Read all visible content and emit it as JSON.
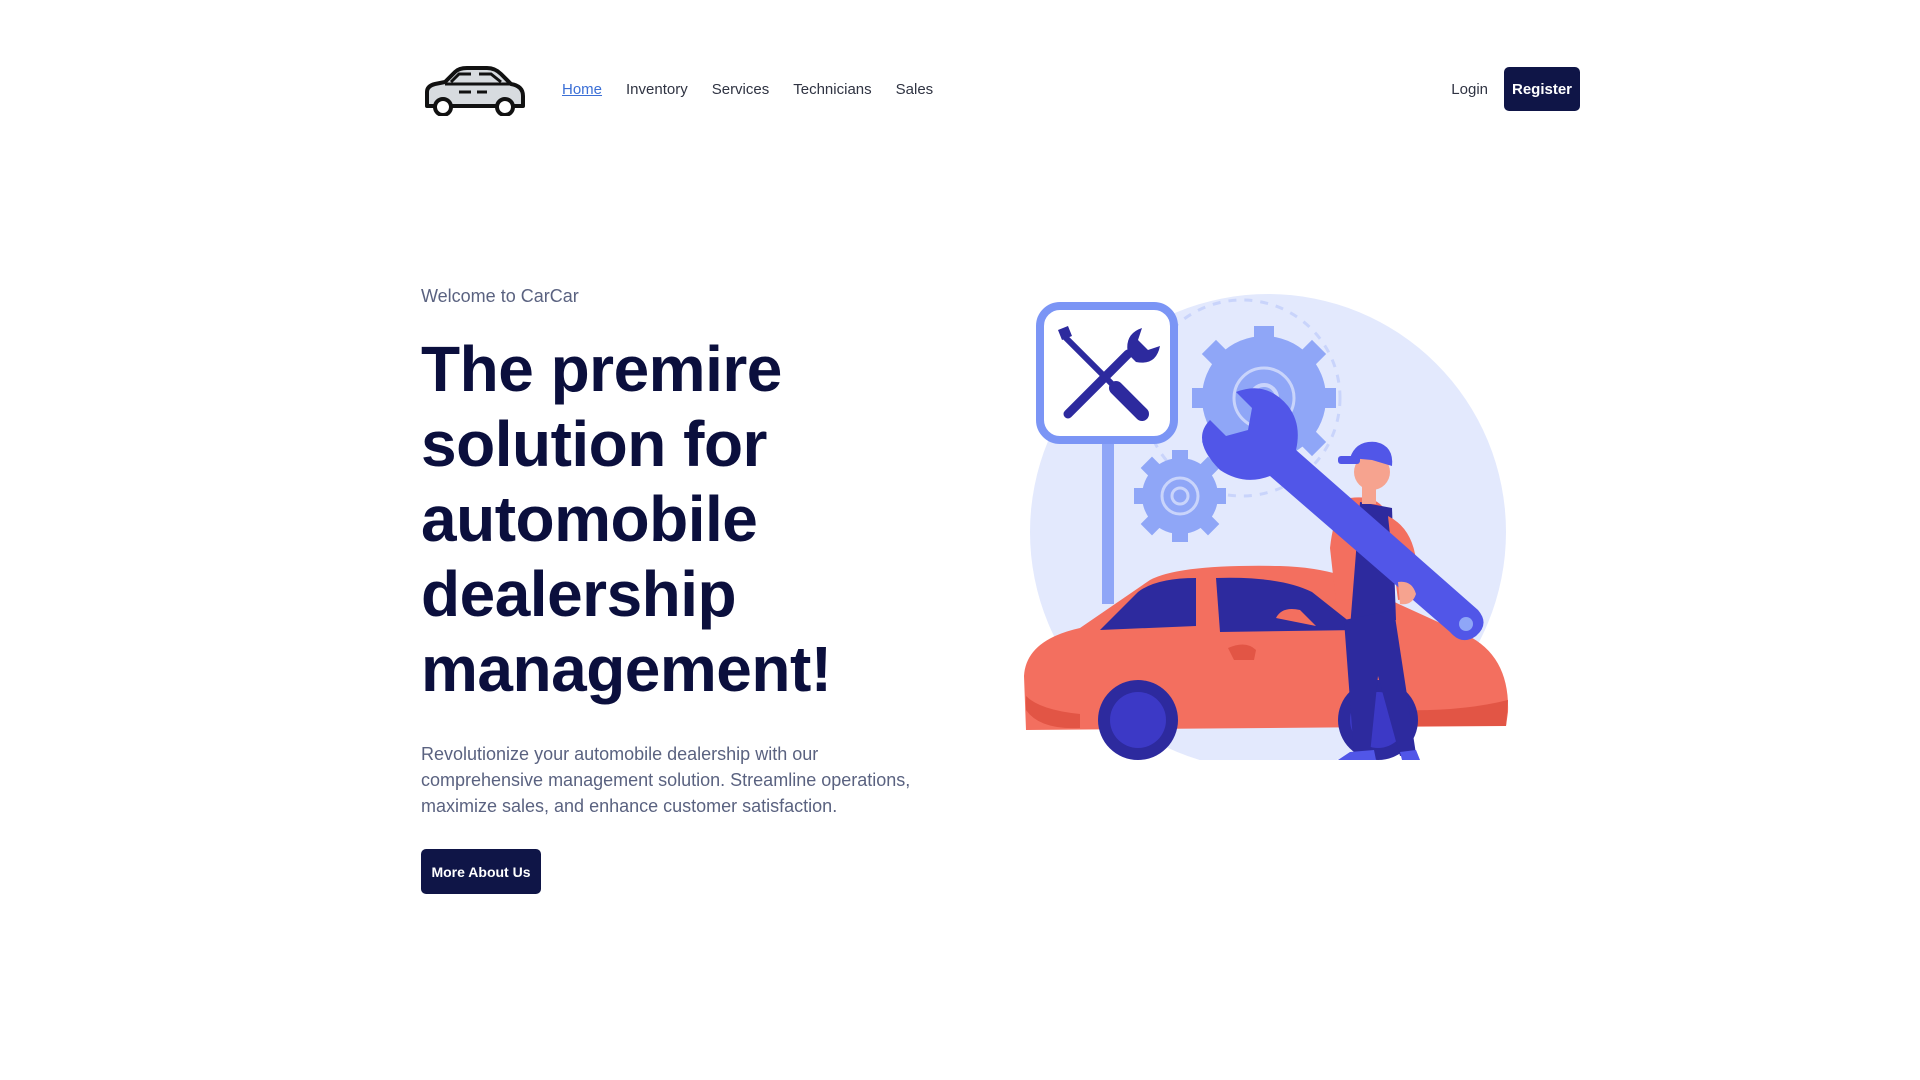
{
  "nav": {
    "items": [
      {
        "label": "Home",
        "active": true
      },
      {
        "label": "Inventory",
        "active": false
      },
      {
        "label": "Services",
        "active": false
      },
      {
        "label": "Technicians",
        "active": false
      },
      {
        "label": "Sales",
        "active": false
      }
    ],
    "login_label": "Login",
    "register_label": "Register"
  },
  "hero": {
    "welcome": "Welcome to CarCar",
    "headline": "The premire solution for automobile dealership management!",
    "description": "Revolutionize your automobile dealership with our comprehensive management solution. Streamline operations, maximize sales, and enhance customer satisfaction.",
    "cta_label": "More About Us"
  },
  "colors": {
    "brand_dark": "#0f1547",
    "link_active": "#3b6fd6",
    "headline": "#0b0f3d",
    "muted_text": "#5a6280",
    "car": "#f36f5f",
    "accent_blue": "#5156e8",
    "gear": "#8fa6f7",
    "bg_circle": "#e3e9fd"
  },
  "icons": {
    "logo": "car-outline-icon",
    "sign": "wrench-screwdriver-icon"
  }
}
